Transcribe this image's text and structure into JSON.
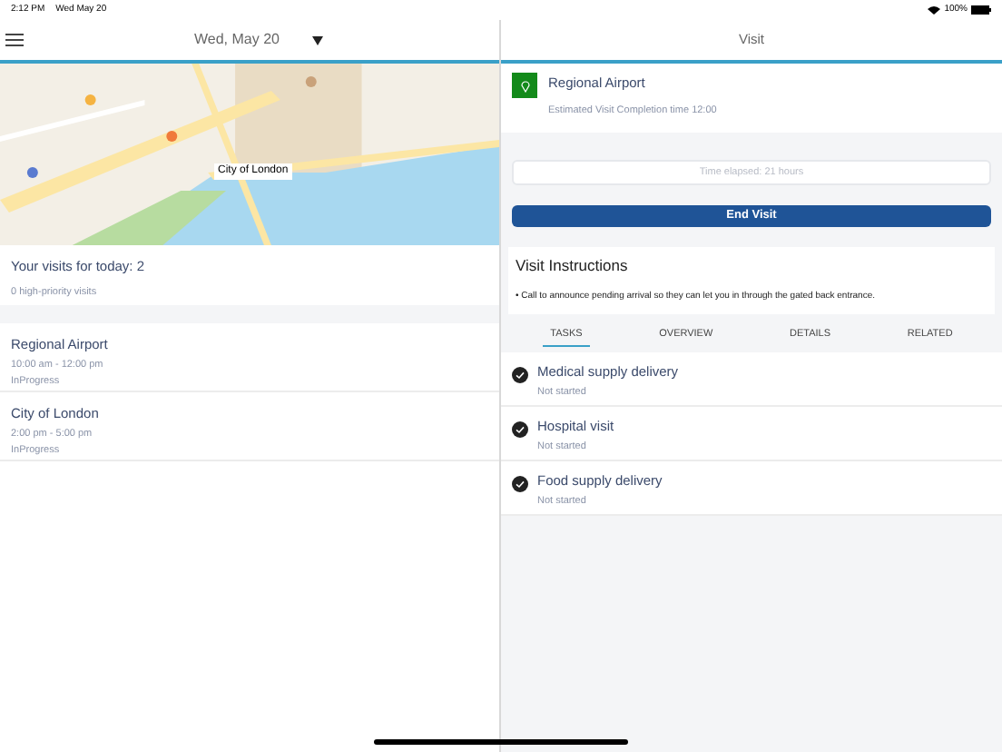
{
  "status_bar": {
    "time": "2:12 PM",
    "date": "Wed May 20",
    "battery": "100%"
  },
  "left": {
    "date": "Wed, May 20",
    "map_label": "City of London",
    "summary": {
      "title": "Your visits for today: 2",
      "subtitle": "0 high-priority visits"
    },
    "visits": [
      {
        "name": "Regional Airport",
        "time": "10:00 am - 12:00 pm",
        "status": "InProgress"
      },
      {
        "name": "City of London",
        "time": "2:00 pm - 5:00 pm",
        "status": "InProgress"
      }
    ]
  },
  "right": {
    "title": "Visit",
    "visit": {
      "name": "Regional Airport",
      "estimate": "Estimated Visit Completion time 12:00"
    },
    "elapsed": {
      "placeholder": "Time elapsed: 21 hours"
    },
    "end_button": "End Visit",
    "instructions": {
      "title": "Visit Instructions",
      "text": "• Call to announce pending arrival so they can let you in through the gated back entrance."
    },
    "tabs": [
      {
        "label": "TASKS",
        "selected": true
      },
      {
        "label": "OVERVIEW",
        "selected": false
      },
      {
        "label": "DETAILS",
        "selected": false
      },
      {
        "label": "RELATED",
        "selected": false
      }
    ],
    "tasks": [
      {
        "name": "Medical supply delivery",
        "status": "Not started",
        "checked": true
      },
      {
        "name": "Hospital visit",
        "status": "Not started",
        "checked": true
      },
      {
        "name": "Food supply delivery",
        "status": "Not started",
        "checked": true
      }
    ]
  }
}
